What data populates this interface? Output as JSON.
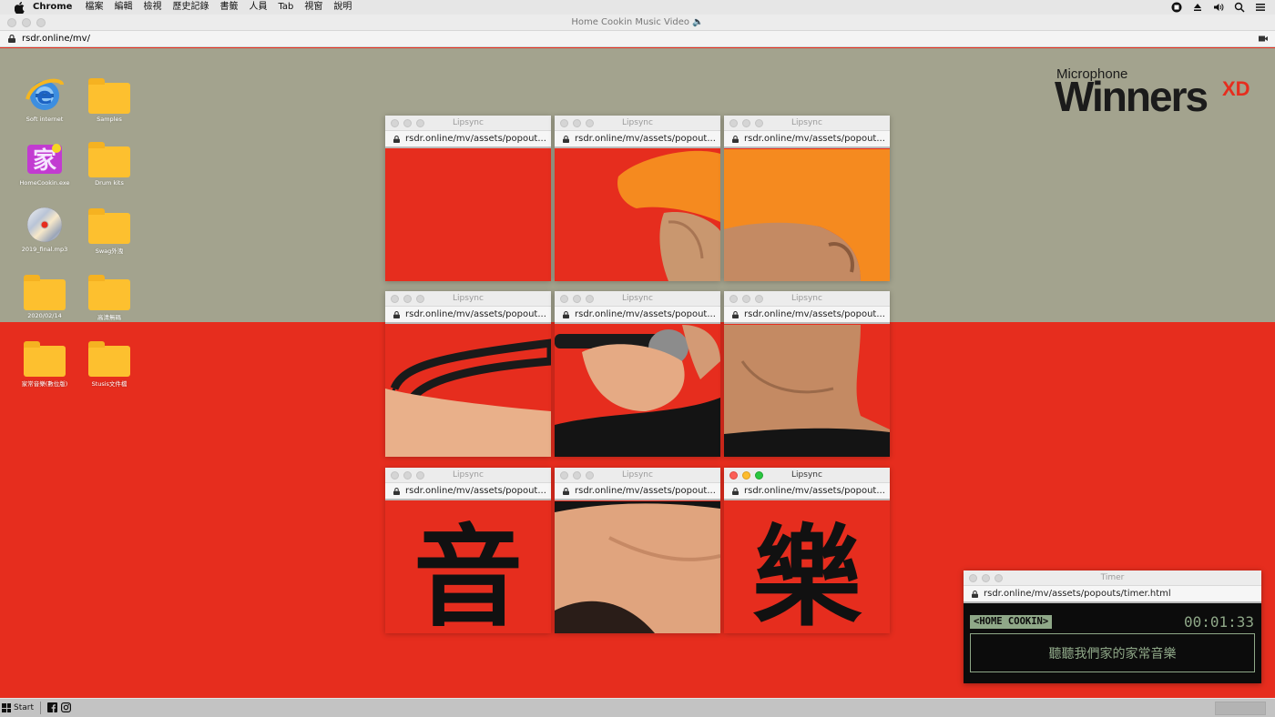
{
  "menubar": {
    "app": "Chrome",
    "items": [
      "檔案",
      "編輯",
      "檢視",
      "歷史記錄",
      "書籤",
      "人員",
      "Tab",
      "視窗",
      "說明"
    ]
  },
  "window": {
    "title": "Home Cookin Music Video 🔈",
    "url": "rsdr.online/mv/"
  },
  "desktop": {
    "icons": [
      {
        "label": "Soft internet",
        "kind": "ie-icon"
      },
      {
        "label": "Samples",
        "kind": "folder-icon"
      },
      {
        "label": "HomeCookin.exe",
        "kind": "app-icon"
      },
      {
        "label": "Drum kits",
        "kind": "folder-icon"
      },
      {
        "label": "2019_final.mp3",
        "kind": "cd-icon"
      },
      {
        "label": "Swag外洩",
        "kind": "folder-icon"
      },
      {
        "label": "2020/02/14",
        "kind": "folder-icon"
      },
      {
        "label": "高清無碼",
        "kind": "folder-icon"
      },
      {
        "label": "家常音樂(數位版)",
        "kind": "folder-icon"
      },
      {
        "label": "Stusis文件檔",
        "kind": "folder-icon"
      }
    ]
  },
  "logo": {
    "small": "Microphone",
    "big": "Winners",
    "suffix": "XD"
  },
  "popouts": {
    "title": "Lipsync",
    "url": "rsdr.online/mv/assets/popout...",
    "char_left": "音",
    "char_right": "樂"
  },
  "timer": {
    "title": "Timer",
    "url": "rsdr.online/mv/assets/popouts/timer.html",
    "tag": "<HOME COOKIN>",
    "time": "00:01:33",
    "message": "聽聽我們家的家常音樂"
  },
  "taskbar": {
    "start": "Start"
  },
  "colors": {
    "red": "#e62d1e",
    "olive": "#a3a38e",
    "orange_cap": "#f58a1f",
    "terminal_green": "#8fa888"
  }
}
